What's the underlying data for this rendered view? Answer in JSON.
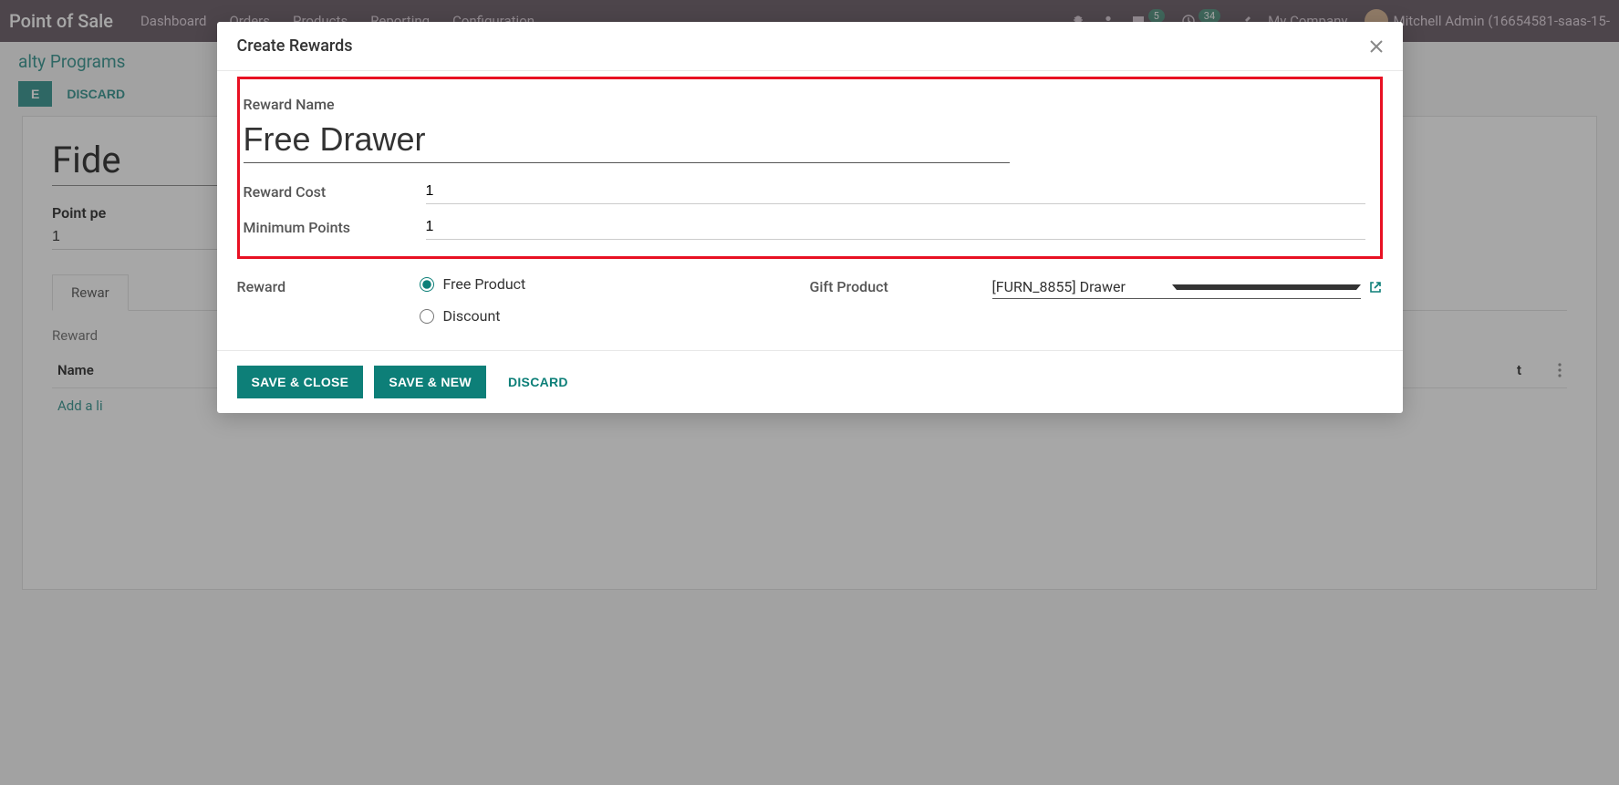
{
  "topbar": {
    "app_name": "Point of Sale",
    "nav": [
      "Dashboard",
      "Orders",
      "Products",
      "Reporting",
      "Configuration"
    ],
    "badge1": "5",
    "badge2": "34",
    "company": "My Company",
    "user": "Mitchell Admin (16654581-saas-15-"
  },
  "breadcrumb": "alty Programs",
  "page_actions": {
    "save": "E",
    "discard": "DISCARD"
  },
  "form": {
    "title": "Fide",
    "point_label": "Point pe",
    "point_value": "1",
    "tab_rewards": "Rewar",
    "reward_col": "Reward ",
    "name_col": "Name",
    "cost_col": "t",
    "add_line": "Add a li"
  },
  "modal": {
    "title": "Create Rewards",
    "reward_name_label": "Reward Name",
    "reward_name_value": "Free Drawer",
    "reward_cost_label": "Reward Cost",
    "reward_cost_value": "1",
    "min_points_label": "Minimum Points",
    "min_points_value": "1",
    "reward_label": "Reward",
    "radio_free": "Free Product",
    "radio_discount": "Discount",
    "gift_product_label": "Gift Product",
    "gift_product_value": "[FURN_8855] Drawer",
    "save_close": "SAVE & CLOSE",
    "save_new": "SAVE & NEW",
    "discard": "DISCARD"
  }
}
